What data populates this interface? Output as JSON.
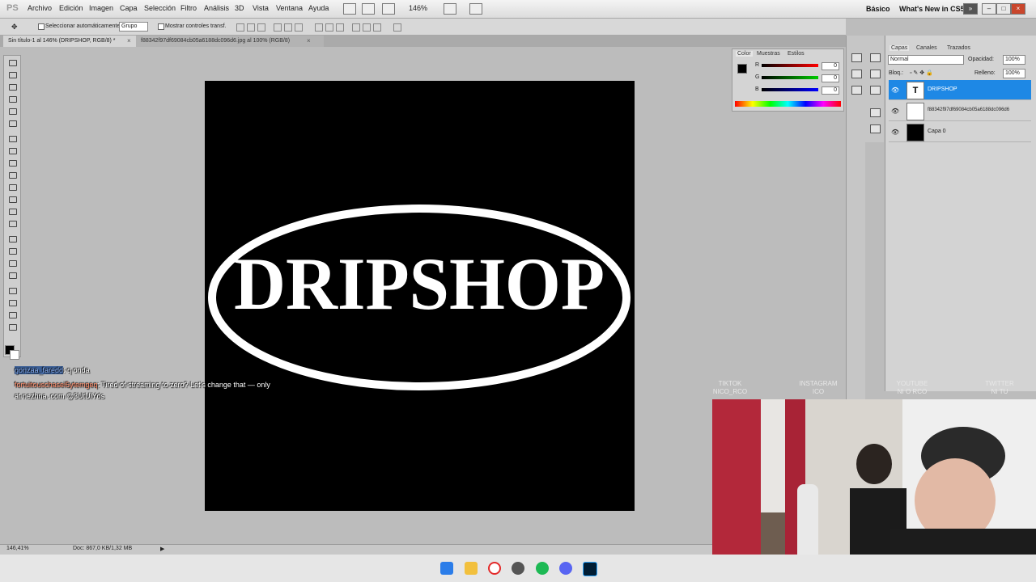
{
  "app": {
    "logo": "PS",
    "menu": [
      "Archivo",
      "Edición",
      "Imagen",
      "Capa",
      "Selección",
      "Filtro",
      "Análisis",
      "3D",
      "Vista",
      "Ventana",
      "Ayuda"
    ],
    "zoom": "146%",
    "workspace": "Básico",
    "whats_new": "What's New in CS5"
  },
  "options": {
    "auto_select_label": "Seleccionar automáticamente:",
    "auto_select_value": "Grupo",
    "transform_label": "Mostrar controles transf."
  },
  "tabs": [
    {
      "label": "Sin título-1 al 146% (DRIPSHOP, RGB/8) *"
    },
    {
      "label": "f88342f97df69084cb05a6188dc096d6.jpg al 100% (RGB/8)"
    }
  ],
  "canvas": {
    "logo_text": "DRIPSHOP",
    "background": "#000000",
    "foreground": "#ffffff"
  },
  "status": {
    "zoom": "146,41%",
    "doc": "Doc: 867,0 KB/1,32 MB"
  },
  "color_panel": {
    "tabs": [
      "Color",
      "Muestras",
      "Estilos"
    ],
    "channels": [
      {
        "label": "R",
        "value": "0"
      },
      {
        "label": "G",
        "value": "0"
      },
      {
        "label": "B",
        "value": "0"
      }
    ]
  },
  "layers_panel": {
    "tabs": [
      "Capas",
      "Canales",
      "Trazados"
    ],
    "blend_mode": "Normal",
    "opacity_label": "Opacidad:",
    "opacity": "100%",
    "lock_label": "Bloq.:",
    "fill_label": "Relleno:",
    "fill": "100%",
    "layers": [
      {
        "name": "DRIPSHOP"
      },
      {
        "name": "f88342f97df69084cb05a6188dc096d6"
      },
      {
        "name": "Capa 0"
      }
    ]
  },
  "chat": [
    {
      "user": "gonzaa_faredd",
      "message": ": q onda"
    },
    {
      "user": "fortuitouschasei5ytemgeq",
      "message": ": Tired of streaming to zero? Let's change that — only",
      "message2": "at nezhna .com @3UtUiYds"
    }
  ],
  "social": [
    {
      "platform": "TIKTOK",
      "handle": "NICO_RCO"
    },
    {
      "platform": "INSTAGRAM",
      "handle": "ICO"
    },
    {
      "platform": "YOUTUBE",
      "handle": "NI O RCO"
    },
    {
      "platform": "TWITTER",
      "handle": "NI TU"
    }
  ],
  "colors": {
    "accent": "#3399ff",
    "selected_layer": "#1e88e5"
  }
}
